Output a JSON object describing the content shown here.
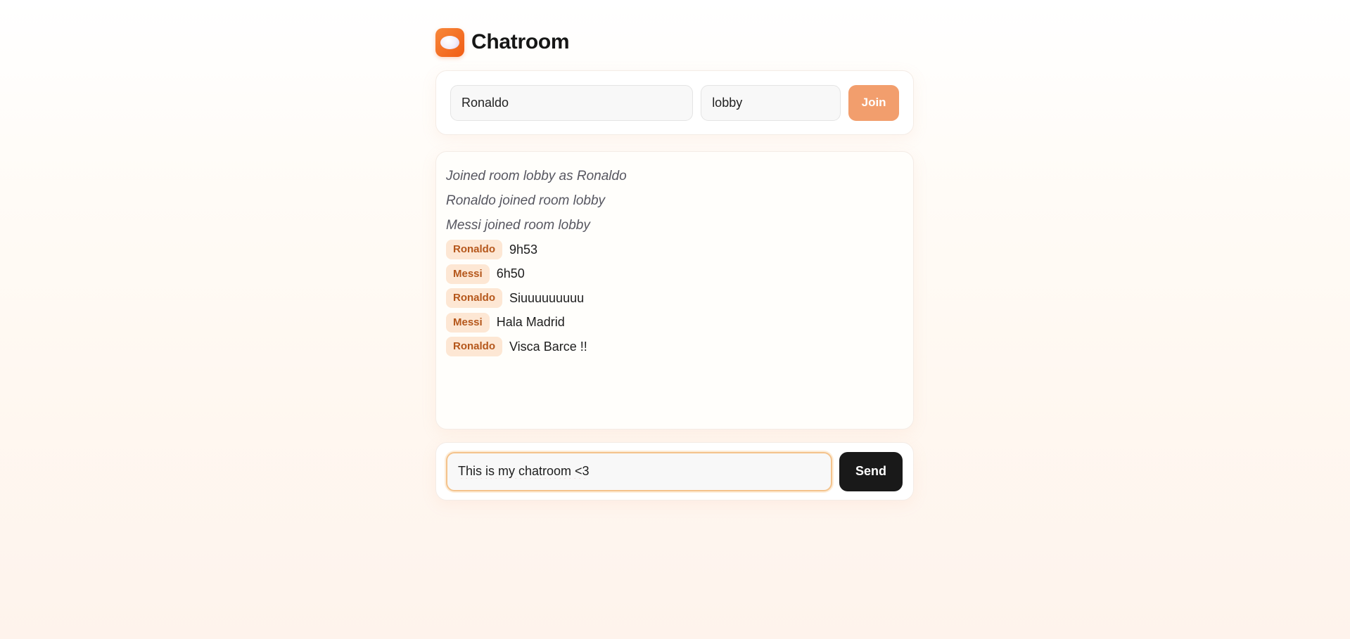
{
  "app": {
    "title": "Chatroom",
    "logo_icon": "chat-bubble-icon",
    "accent_color": "#f15d15"
  },
  "join_form": {
    "username_value": "Ronaldo",
    "room_value": "lobby",
    "join_label": "Join"
  },
  "messages": {
    "system": [
      "Joined room lobby as Ronaldo",
      "Ronaldo joined room lobby",
      "Messi joined room lobby"
    ],
    "chat": [
      {
        "user": "Ronaldo",
        "text": "9h53"
      },
      {
        "user": "Messi",
        "text": "6h50"
      },
      {
        "user": "Ronaldo",
        "text": "Siuuuuuuuuu"
      },
      {
        "user": "Messi",
        "text": "Hala Madrid"
      },
      {
        "user": "Ronaldo",
        "text": "Visca Barce !!"
      }
    ]
  },
  "composer": {
    "message_value": "This is my chatroom <3",
    "send_label": "Send"
  }
}
